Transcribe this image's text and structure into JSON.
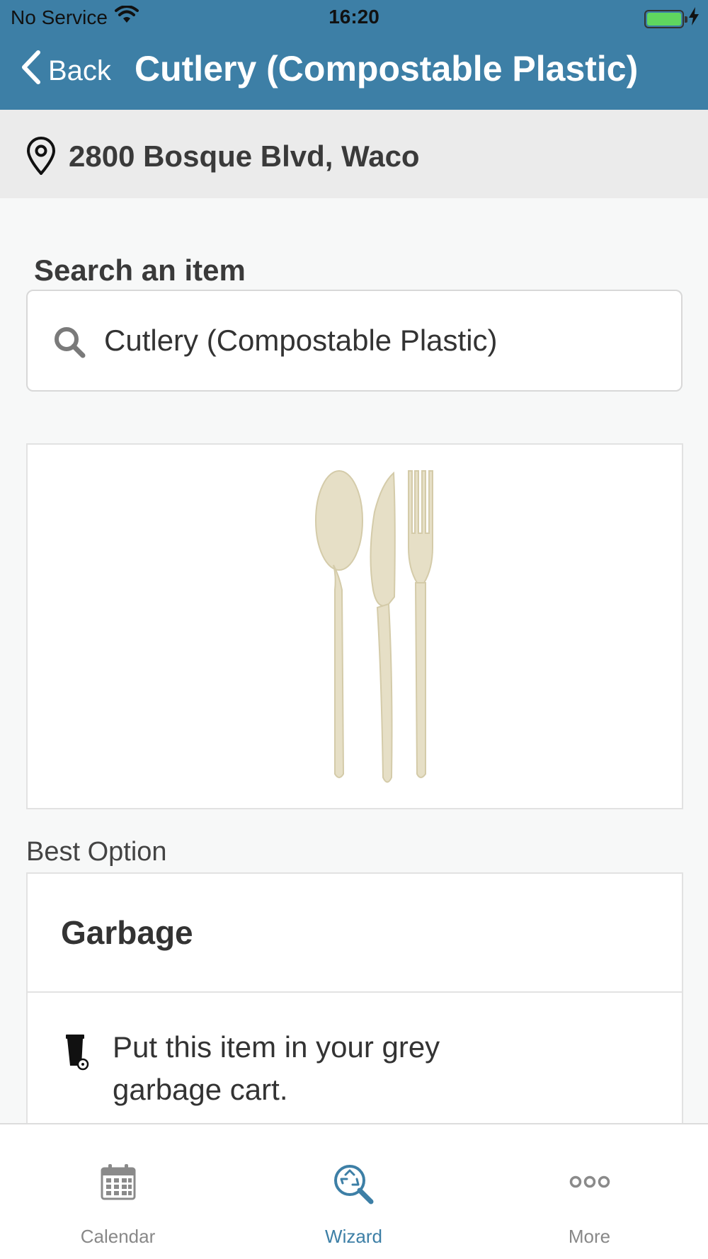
{
  "status_bar": {
    "carrier": "No Service",
    "time": "16:20"
  },
  "nav": {
    "back_label": "Back",
    "title": "Cutlery (Compostable Plastic)"
  },
  "location": {
    "address": "2800 Bosque Blvd, Waco"
  },
  "search": {
    "label": "Search an item",
    "value": "Cutlery (Compostable Plastic)"
  },
  "result": {
    "section_label": "Best Option",
    "option_title": "Garbage",
    "option_description": "Put this item in your grey garbage cart."
  },
  "tabs": [
    {
      "label": "Calendar",
      "icon": "calendar-icon",
      "active": false
    },
    {
      "label": "Wizard",
      "icon": "wizard-search-icon",
      "active": true
    },
    {
      "label": "More",
      "icon": "more-icon",
      "active": false
    }
  ],
  "colors": {
    "header": "#3d7fa6",
    "accent": "#3d7fa6",
    "inactive_tab": "#888888"
  }
}
